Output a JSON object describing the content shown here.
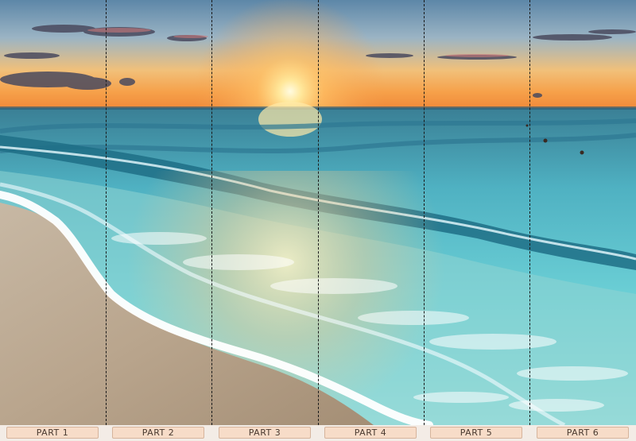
{
  "parts": [
    {
      "label": "PART 1"
    },
    {
      "label": "PART 2"
    },
    {
      "label": "PART 3"
    },
    {
      "label": "PART 4"
    },
    {
      "label": "PART 5"
    },
    {
      "label": "PART 6"
    }
  ]
}
